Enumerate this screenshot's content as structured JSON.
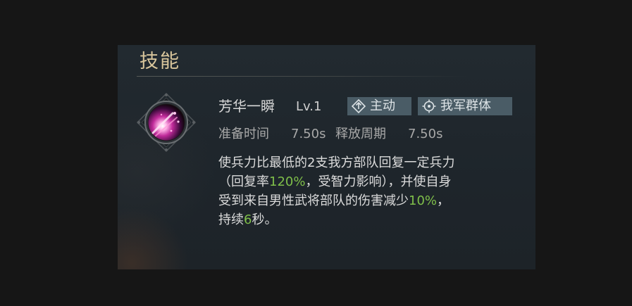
{
  "section": {
    "title": "技能"
  },
  "skill": {
    "name": "芳华一瞬",
    "level": "Lv.1",
    "tags": [
      {
        "icon": "diamond-arrow-icon",
        "label": "主动"
      },
      {
        "icon": "crosshair-icon",
        "label": "我军群体"
      }
    ],
    "prep_label": "准备时间",
    "prep_value": "7.50s",
    "cycle_label": "释放周期",
    "cycle_value": "7.50s",
    "description": {
      "line1": "使兵力比最低的2支我方部队回复一定兵力",
      "line2_a": "（回复率",
      "line2_hl": "120%",
      "line2_b": "，受智力影响），并使自身",
      "line3_a": "受到来自男性武将部队的伤害减少",
      "line3_hl": "10%",
      "line3_b": "，",
      "line4_a": "持续",
      "line4_hl": "6",
      "line4_b": "秒。"
    }
  },
  "colors": {
    "title": "#d9c69c",
    "highlight": "#7fbf4a",
    "tag_bg": "#4a5c66"
  }
}
